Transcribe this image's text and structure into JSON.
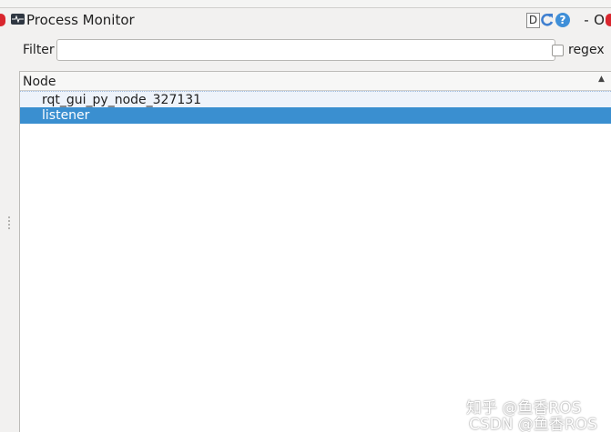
{
  "window": {
    "title": "Process Monitor",
    "app_icon": "monitor-pulse-icon",
    "buttons": {
      "dock_label": "D",
      "reload_icon": "reload-icon",
      "help_label": "?",
      "minimize_label": "-",
      "float_label": "O"
    }
  },
  "filter": {
    "label": "Filter",
    "value": "",
    "placeholder": "",
    "regex_label": "regex",
    "regex_checked": false
  },
  "tree": {
    "column_header": "Node",
    "sort_indicator": "▲",
    "rows": [
      {
        "label": "rqt_gui_py_node_327131",
        "selected": false
      },
      {
        "label": "listener",
        "selected": true
      }
    ]
  },
  "watermark": {
    "line1": "知乎 @鱼香ROS",
    "line2": "CSDN @鱼香ROS"
  },
  "colors": {
    "selection": "#3a8fd0",
    "help_button": "#3f8fd8",
    "edge_indicator": "#d9262e"
  }
}
